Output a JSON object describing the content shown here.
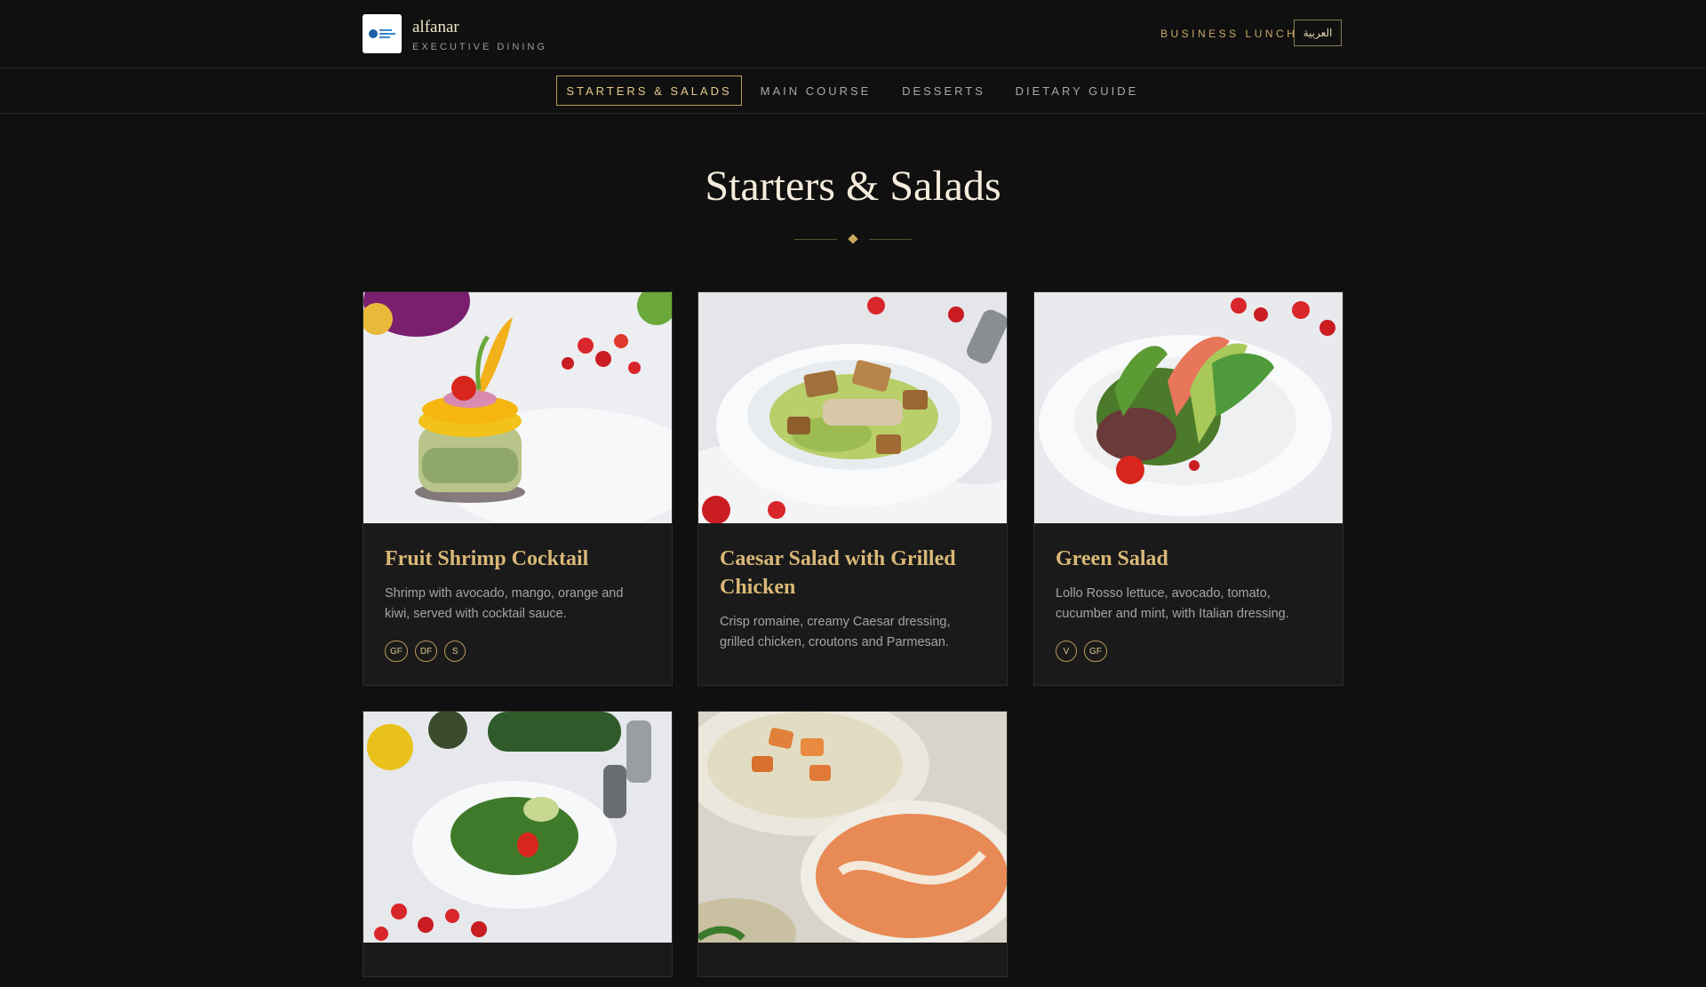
{
  "header": {
    "brand_name": "alfanar",
    "brand_subtitle": "EXECUTIVE DINING",
    "menu_label": "BUSINESS LUNCH",
    "language_button": "العربية"
  },
  "nav": {
    "tabs": [
      {
        "label": "STARTERS & SALADS",
        "active": true
      },
      {
        "label": "MAIN COURSE",
        "active": false
      },
      {
        "label": "DESSERTS",
        "active": false
      },
      {
        "label": "DIETARY GUIDE",
        "active": false
      }
    ]
  },
  "section": {
    "title": "Starters & Salads"
  },
  "dishes": [
    {
      "name": "Fruit Shrimp Cocktail",
      "description": "Shrimp with avocado, mango, orange and kiwi, served with cocktail sauce.",
      "tags": [
        "GF",
        "DF",
        "S"
      ],
      "image": "fruit-shrimp-cocktail-photo"
    },
    {
      "name": "Caesar Salad with Grilled Chicken",
      "description": "Crisp romaine, creamy Caesar dressing, grilled chicken, croutons and Parmesan.",
      "tags": [],
      "image": "caesar-salad-photo"
    },
    {
      "name": "Green Salad",
      "description": "Lollo Rosso lettuce, avocado, tomato, cucumber and mint, with Italian dressing.",
      "tags": [
        "V",
        "GF"
      ],
      "image": "green-salad-photo"
    },
    {
      "name": "",
      "description": "",
      "tags": [],
      "image": "arugula-salad-photo"
    },
    {
      "name": "",
      "description": "",
      "tags": [],
      "image": "soup-bowls-photo"
    }
  ],
  "colors": {
    "background": "#101010",
    "accent_gold": "#c9a86a",
    "card_bg": "#1a1a1a"
  }
}
